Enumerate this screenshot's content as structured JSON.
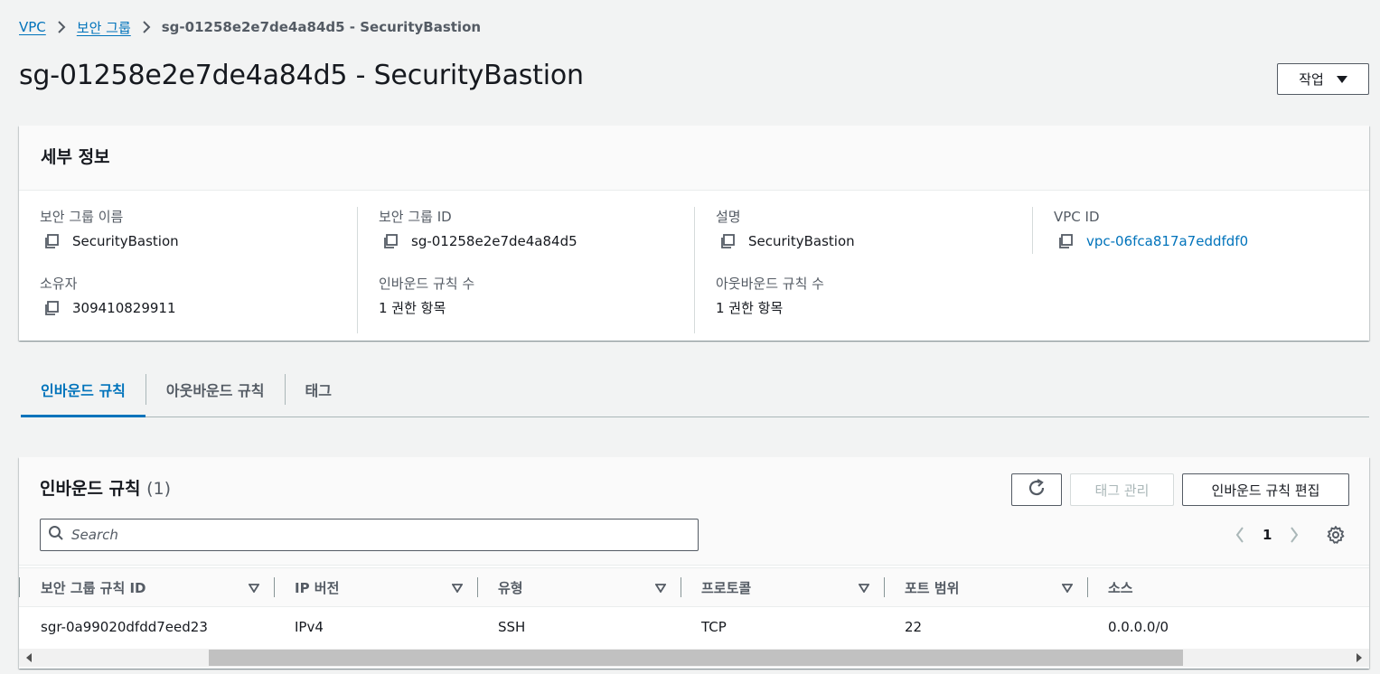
{
  "breadcrumb": {
    "items": [
      "VPC",
      "보안 그룹"
    ],
    "current": "sg-01258e2e7de4a84d5 - SecurityBastion"
  },
  "page": {
    "title": "sg-01258e2e7de4a84d5 - SecurityBastion",
    "actions_label": "작업"
  },
  "details": {
    "title": "세부 정보",
    "fields": [
      {
        "label": "보안 그룹 이름",
        "value": "SecurityBastion"
      },
      {
        "label": "보안 그룹 ID",
        "value": "sg-01258e2e7de4a84d5"
      },
      {
        "label": "설명",
        "value": "SecurityBastion"
      },
      {
        "label": "VPC ID",
        "value": "vpc-06fca817a7eddfdf0"
      },
      {
        "label": "소유자",
        "value": "309410829911"
      },
      {
        "label": "인바운드 규칙 수",
        "value": "1 권한 항목"
      },
      {
        "label": "아웃바운드 규칙 수",
        "value": "1 권한 항목"
      }
    ]
  },
  "tabs": [
    {
      "label": "인바운드 규칙"
    },
    {
      "label": "아웃바운드 규칙"
    },
    {
      "label": "태그"
    }
  ],
  "rules": {
    "title": "인바운드 규칙",
    "count": "(1)",
    "manage_tags_label": "태그 관리",
    "edit_label": "인바운드 규칙 편집",
    "search_placeholder": "Search",
    "page": "1",
    "columns": [
      "보안 그룹 규칙 ID",
      "IP 버전",
      "유형",
      "프로토콜",
      "포트 범위",
      "소스"
    ],
    "rows": [
      [
        "sgr-0a99020dfdd7eed23",
        "IPv4",
        "SSH",
        "TCP",
        "22",
        "0.0.0.0/0"
      ]
    ]
  },
  "colors": {
    "link": "#0073bb",
    "text": "#16191f",
    "muted": "#545b64",
    "background": "#f2f3f3"
  }
}
